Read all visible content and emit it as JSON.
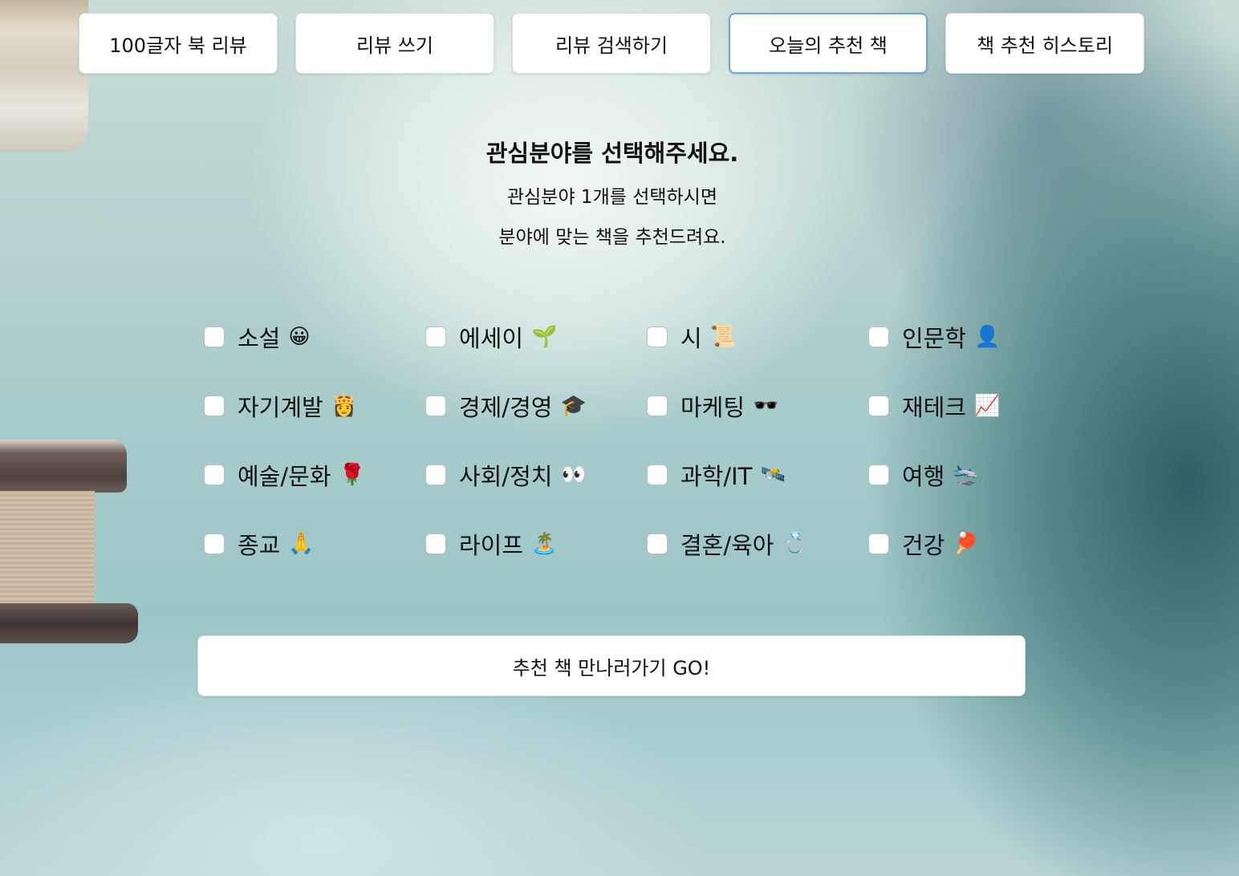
{
  "nav": {
    "items": [
      {
        "label": "100글자 북 리뷰",
        "active": false
      },
      {
        "label": "리뷰 쓰기",
        "active": false
      },
      {
        "label": "리뷰 검색하기",
        "active": false
      },
      {
        "label": "오늘의 추천 책",
        "active": true
      },
      {
        "label": "책 추천 히스토리",
        "active": false
      }
    ]
  },
  "intro": {
    "title": "관심분야를 선택해주세요.",
    "line1": "관심분야 1개를 선택하시면",
    "line2": "분야에 맞는 책을 추천드려요."
  },
  "categories": [
    {
      "label": "소설",
      "emoji": "😀",
      "icon": "grinning-face-icon",
      "checked": false
    },
    {
      "label": "에세이",
      "emoji": "🌱",
      "icon": "seedling-icon",
      "checked": false
    },
    {
      "label": "시",
      "emoji": "📜",
      "icon": "scroll-icon",
      "checked": false
    },
    {
      "label": "인문학",
      "emoji": "👤",
      "icon": "person-silhouette-icon",
      "checked": false
    },
    {
      "label": "자기계발",
      "emoji": "👸",
      "icon": "princess-icon",
      "checked": false
    },
    {
      "label": "경제/경영",
      "emoji": "🎓",
      "icon": "graduation-cap-icon",
      "checked": false
    },
    {
      "label": "마케팅",
      "emoji": "🕶️",
      "icon": "sunglasses-icon",
      "checked": false
    },
    {
      "label": "재테크",
      "emoji": "📈",
      "icon": "chart-increasing-icon",
      "checked": false
    },
    {
      "label": "예술/문화",
      "emoji": "🌹",
      "icon": "rose-icon",
      "checked": false
    },
    {
      "label": "사회/정치",
      "emoji": "👀",
      "icon": "eyes-icon",
      "checked": false
    },
    {
      "label": "과학/IT",
      "emoji": "🛰️",
      "icon": "satellite-icon",
      "checked": false
    },
    {
      "label": "여행",
      "emoji": "🛬",
      "icon": "airplane-arrival-icon",
      "checked": false
    },
    {
      "label": "종교",
      "emoji": "🙏",
      "icon": "folded-hands-icon",
      "checked": false
    },
    {
      "label": "라이프",
      "emoji": "🏝️",
      "icon": "island-icon",
      "checked": false
    },
    {
      "label": "결혼/육아",
      "emoji": "💍",
      "icon": "ring-icon",
      "checked": false
    },
    {
      "label": "건강",
      "emoji": "🏓",
      "icon": "ping-pong-icon",
      "checked": false
    }
  ],
  "submit": {
    "label": "추천 책 만나러가기 GO!"
  }
}
